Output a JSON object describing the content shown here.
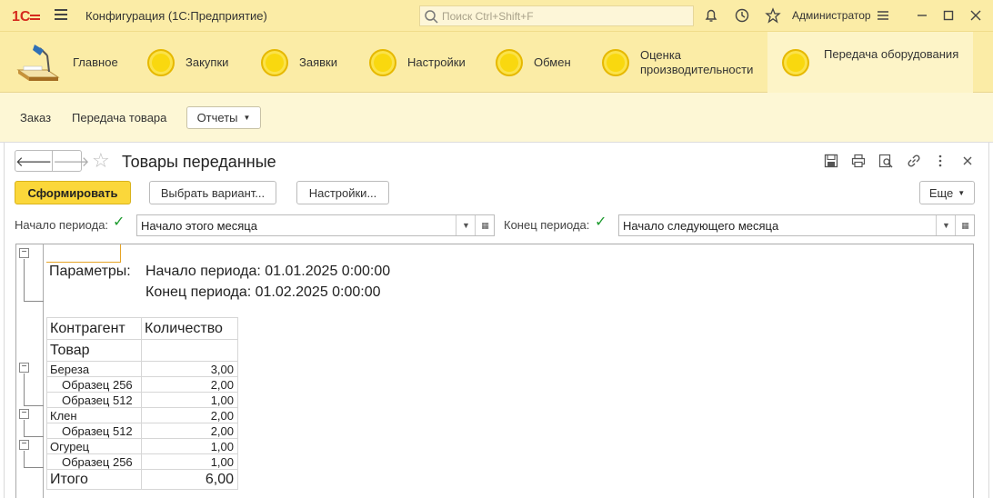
{
  "titlebar": {
    "app_title": "Конфигурация (1С:Предприятие)",
    "search_placeholder": "Поиск Ctrl+Shift+F",
    "user": "Администратор"
  },
  "sections": [
    {
      "label": "Главное"
    },
    {
      "label": "Закупки"
    },
    {
      "label": "Заявки"
    },
    {
      "label": "Настройки"
    },
    {
      "label": "Обмен"
    },
    {
      "label": "Оценка производительности"
    },
    {
      "label": "Передача оборудования"
    }
  ],
  "subbar": {
    "order": "Заказ",
    "transfer": "Передача товара",
    "reports": "Отчеты"
  },
  "form": {
    "title": "Товары переданные",
    "generate": "Сформировать",
    "choose_variant": "Выбрать вариант...",
    "settings": "Настройки...",
    "more": "Еще",
    "period_start_label": "Начало периода:",
    "period_start_value": "Начало этого месяца",
    "period_end_label": "Конец периода:",
    "period_end_value": "Начало следующего месяца"
  },
  "report": {
    "params_label": "Параметры:",
    "param_start": "Начало периода: 01.01.2025 0:00:00",
    "param_end": "Конец периода: 01.02.2025 0:00:00",
    "headers": {
      "counterparty": "Контрагент",
      "quantity": "Количество",
      "product": "Товар"
    },
    "rows": [
      {
        "name": "Береза",
        "qty": "3,00",
        "level": 0
      },
      {
        "name": "Образец 256",
        "qty": "2,00",
        "level": 1
      },
      {
        "name": "Образец 512",
        "qty": "1,00",
        "level": 1
      },
      {
        "name": "Клен",
        "qty": "2,00",
        "level": 0
      },
      {
        "name": "Образец 512",
        "qty": "2,00",
        "level": 1
      },
      {
        "name": "Огурец",
        "qty": "1,00",
        "level": 0
      },
      {
        "name": "Образец 256",
        "qty": "1,00",
        "level": 1
      }
    ],
    "total_label": "Итого",
    "total_value": "6,00"
  },
  "colors": {
    "accent_yellow": "#fbeca6",
    "primary_button": "#fbd73a",
    "checkbox_green": "#1e9b2f"
  }
}
